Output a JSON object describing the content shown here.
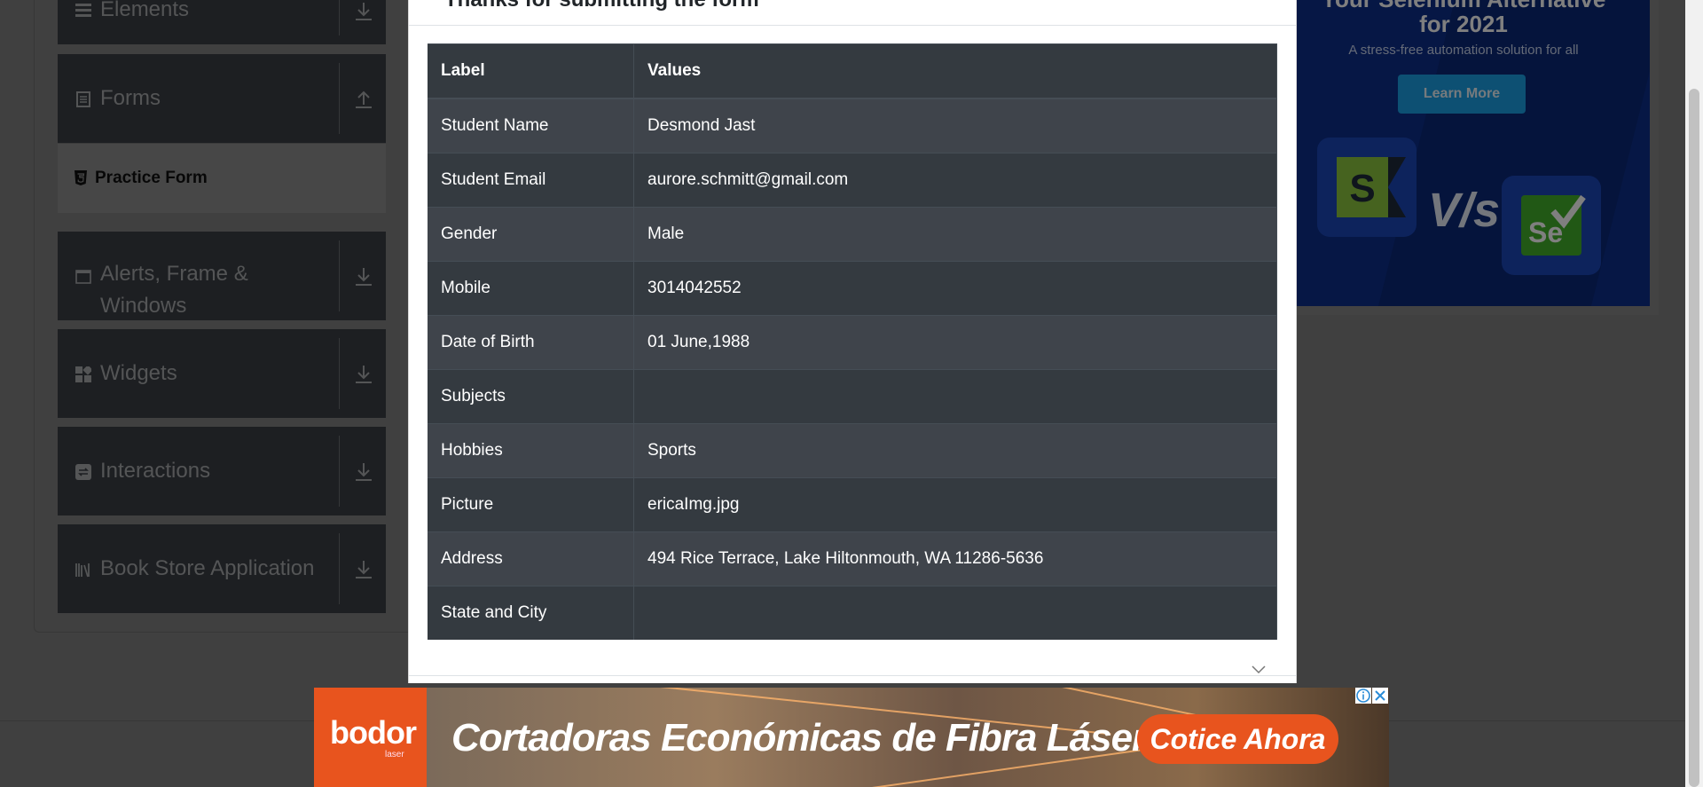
{
  "sidebar": {
    "groups": [
      {
        "label": "Elements",
        "icon": "list-icon",
        "arrow": "download-icon"
      },
      {
        "label": "Forms",
        "icon": "document-icon",
        "arrow": "upload-icon"
      },
      {
        "label": "Alerts, Frame &",
        "label2": "Windows",
        "icon": "window-icon",
        "arrow": "download-icon"
      },
      {
        "label": "Widgets",
        "icon": "widgets-icon",
        "arrow": "download-icon"
      },
      {
        "label": "Interactions",
        "icon": "interactions-icon",
        "arrow": "download-icon"
      },
      {
        "label": "Book Store Application",
        "icon": "books-icon",
        "arrow": "download-icon"
      }
    ],
    "active_item": {
      "label": "Practice Form",
      "icon": "html5-icon"
    }
  },
  "side_ad": {
    "title_line1": "Your Selenium Alternative",
    "title_line2": "for 2021",
    "subtitle": "A stress-free automation solution for all",
    "button": "Learn More",
    "vs": "V/s",
    "logo_right": "Se"
  },
  "modal": {
    "title": "Thanks for submitting the form",
    "table": {
      "headers": [
        "Label",
        "Values"
      ],
      "rows": [
        [
          "Student Name",
          "Desmond Jast"
        ],
        [
          "Student Email",
          "aurore.schmitt@gmail.com"
        ],
        [
          "Gender",
          "Male"
        ],
        [
          "Mobile",
          "3014042552"
        ],
        [
          "Date of Birth",
          "01 June,1988"
        ],
        [
          "Subjects",
          ""
        ],
        [
          "Hobbies",
          "Sports"
        ],
        [
          "Picture",
          "ericaImg.jpg"
        ],
        [
          "Address",
          "494 Rice Terrace, Lake Hiltonmouth, WA 11286-5636"
        ],
        [
          "State and City",
          ""
        ]
      ]
    }
  },
  "banner": {
    "logo": "bodor",
    "logo_small": "laser",
    "headline": "Cortadoras Económicas de Fibra Láser",
    "cta": "Cotice Ahora"
  },
  "colors": {
    "sidebar_bg": "#3b3f45",
    "table_dark": "#343a40",
    "table_stripe": "#3f444b",
    "ad_orange": "#e8541e",
    "ad_blue": "#1aa0e6"
  }
}
